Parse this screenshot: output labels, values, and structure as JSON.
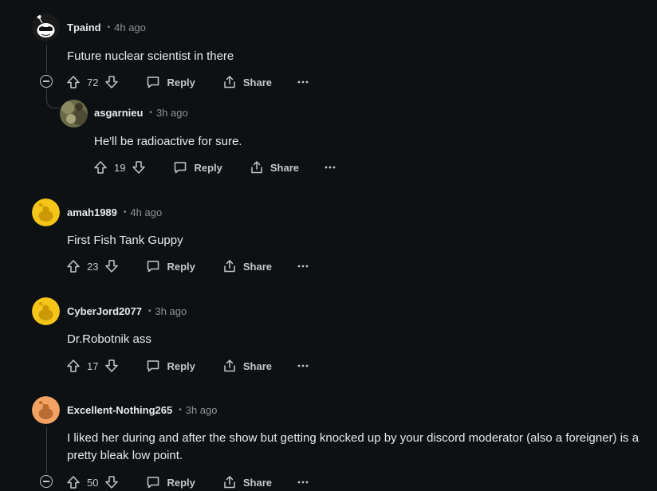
{
  "comments": [
    {
      "author": "Tpaind",
      "time": "4h ago",
      "text": "Future nuclear scientist in there",
      "score": "72",
      "reply_label": "Reply",
      "share_label": "Share"
    },
    {
      "author": "asgarnieu",
      "time": "3h ago",
      "text": "He'll be radioactive for sure.",
      "score": "19",
      "reply_label": "Reply",
      "share_label": "Share"
    },
    {
      "author": "amah1989",
      "time": "4h ago",
      "text": "First Fish Tank Guppy",
      "score": "23",
      "reply_label": "Reply",
      "share_label": "Share"
    },
    {
      "author": "CyberJord2077",
      "time": "3h ago",
      "text": "Dr.Robotnik ass",
      "score": "17",
      "reply_label": "Reply",
      "share_label": "Share"
    },
    {
      "author": "Excellent-Nothing265",
      "time": "3h ago",
      "text": "I liked her during and after the show but getting knocked up by your discord moderator (also a foreigner) is a pretty bleak low point.",
      "score": "50",
      "reply_label": "Reply",
      "share_label": "Share"
    }
  ],
  "icons": {
    "upvote": "upvote-icon",
    "downvote": "downvote-icon",
    "reply": "comment-bubble-icon",
    "share": "share-icon",
    "more": "more-options-icon",
    "collapse": "collapse-thread-icon"
  },
  "colors": {
    "background": "#0e1113",
    "snoo_yellow": "#f5c518",
    "snoo_orange": "#f4a261"
  }
}
